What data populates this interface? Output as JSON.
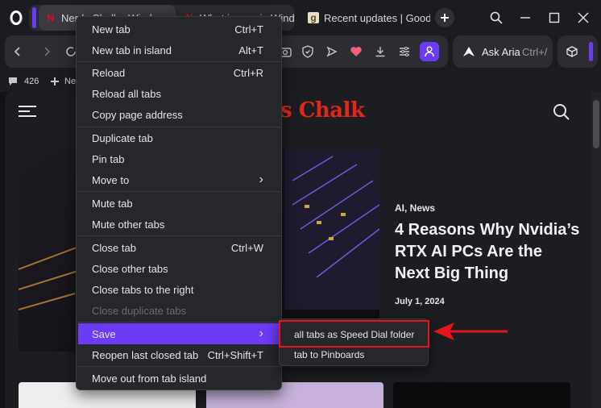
{
  "browser": {
    "tabs": [
      {
        "title": "Nerds Chalk - Windows",
        "favicon": "N",
        "favicon_color": "#e50914"
      },
      {
        "title": "What is new in Windows",
        "favicon": "N",
        "favicon_color": "#e50914"
      },
      {
        "title": "Recent updates | Goodreads",
        "favicon": "g",
        "favicon_color": "#b6a27a"
      }
    ],
    "new_tab_icon": "plus-icon",
    "window_controls": [
      "search-icon",
      "minimize-icon",
      "maximize-icon",
      "close-icon"
    ],
    "aria": {
      "label": "Ask Aria",
      "shortcut": "Ctrl+/"
    }
  },
  "bookmarks": {
    "count": "426",
    "new_label": "Ne"
  },
  "page": {
    "logo": "s Chalk",
    "categories": "AI, News",
    "headline": "4 Reasons Why Nvidia’s RTX AI PCs Are the Next Big Thing",
    "date": "July 1, 2024"
  },
  "context_menu": {
    "items": [
      {
        "label": "New tab",
        "shortcut": "Ctrl+T"
      },
      {
        "label": "New tab in island",
        "shortcut": "Alt+T"
      },
      {
        "label": "Reload",
        "shortcut": "Ctrl+R"
      },
      {
        "label": "Reload all tabs",
        "shortcut": ""
      },
      {
        "label": "Copy page address",
        "shortcut": ""
      },
      {
        "label": "Duplicate tab",
        "shortcut": ""
      },
      {
        "label": "Pin tab",
        "shortcut": ""
      },
      {
        "label": "Move to",
        "shortcut": "›"
      },
      {
        "label": "Mute tab",
        "shortcut": ""
      },
      {
        "label": "Mute other tabs",
        "shortcut": ""
      },
      {
        "label": "Close tab",
        "shortcut": "Ctrl+W"
      },
      {
        "label": "Close other tabs",
        "shortcut": ""
      },
      {
        "label": "Close tabs to the right",
        "shortcut": ""
      },
      {
        "label": "Close duplicate tabs",
        "shortcut": ""
      },
      {
        "label": "Save",
        "shortcut": "›"
      },
      {
        "label": "Reopen last closed tab",
        "shortcut": "Ctrl+Shift+T"
      },
      {
        "label": "Move out from tab island",
        "shortcut": ""
      }
    ],
    "submenu": [
      {
        "label": "all tabs as Speed Dial folder"
      },
      {
        "label": "tab to Pinboards"
      }
    ]
  },
  "colors": {
    "accent": "#6b3bf5",
    "annotation_red": "#e8141c",
    "logo_red": "#e3261c"
  }
}
